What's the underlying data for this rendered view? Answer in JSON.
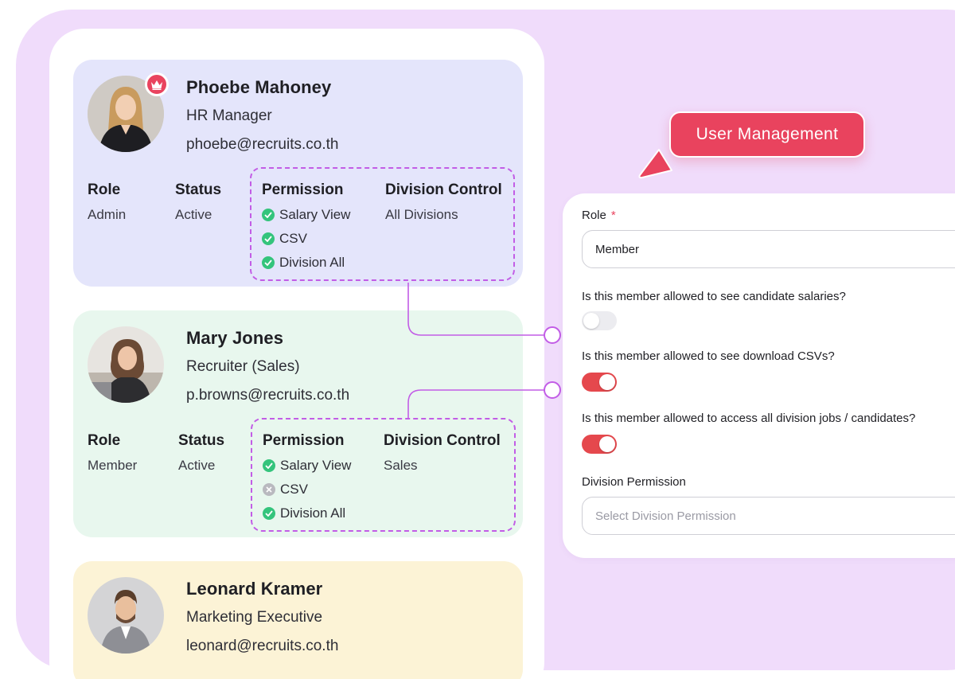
{
  "users": [
    {
      "name": "Phoebe Mahoney",
      "job_title": "HR Manager",
      "email": "phoebe@recruits.co.th",
      "is_owner": true,
      "role_label": "Role",
      "role": "Admin",
      "status_label": "Status",
      "status": "Active",
      "permission_label": "Permission",
      "permissions": [
        {
          "label": "Salary View",
          "enabled": true
        },
        {
          "label": "CSV",
          "enabled": true
        },
        {
          "label": "Division All",
          "enabled": true
        }
      ],
      "division_label": "Division Control",
      "division": "All Divisions"
    },
    {
      "name": "Mary Jones",
      "job_title": "Recruiter (Sales)",
      "email": "p.browns@recruits.co.th",
      "is_owner": false,
      "role_label": "Role",
      "role": "Member",
      "status_label": "Status",
      "status": "Active",
      "permission_label": "Permission",
      "permissions": [
        {
          "label": "Salary View",
          "enabled": true
        },
        {
          "label": "CSV",
          "enabled": false
        },
        {
          "label": "Division All",
          "enabled": true
        }
      ],
      "division_label": "Division Control",
      "division": "Sales"
    },
    {
      "name": "Leonard Kramer",
      "job_title": "Marketing Executive",
      "email": "leonard@recruits.co.th"
    }
  ],
  "badge": {
    "label": "User Management"
  },
  "form": {
    "role_label": "Role",
    "role_required_mark": "*",
    "role_value": "Member",
    "q_salary": "Is this member allowed to see candidate salaries?",
    "q_salary_on": false,
    "q_csv": "Is this member allowed to see download CSVs?",
    "q_csv_on": true,
    "q_division": "Is this member allowed to access all division jobs / candidates?",
    "q_division_on": true,
    "division_label": "Division Permission",
    "division_placeholder": "Select Division Permission"
  },
  "colors": {
    "accent": "#e9435e",
    "toggle_on": "#e5484d",
    "check_ok": "#34c47c",
    "check_off": "#b9b9bf",
    "dashed_border": "#c25de6",
    "background": "#f0dcfb"
  }
}
